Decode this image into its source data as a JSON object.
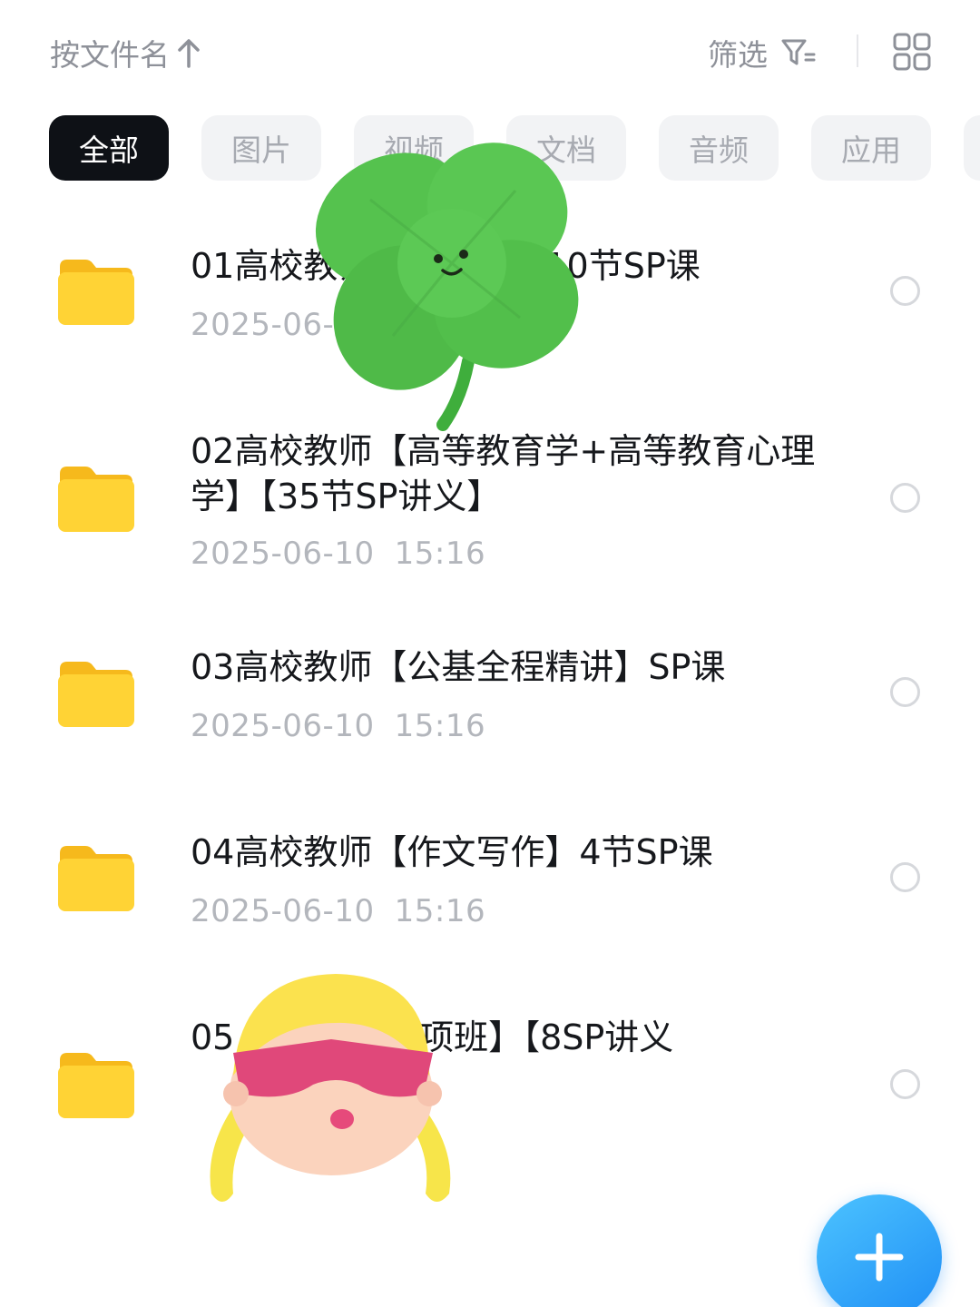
{
  "topbar": {
    "sort_label": "按文件名",
    "sort_direction_icon": "arrow-up-icon",
    "filter_label": "筛选",
    "filter_icon": "filter-icon",
    "grid_icon": "grid-view-icon"
  },
  "tabs": [
    {
      "label": "全部",
      "active": true
    },
    {
      "label": "图片"
    },
    {
      "label": "视频"
    },
    {
      "label": "文档"
    },
    {
      "label": "音频"
    },
    {
      "label": "应用"
    }
  ],
  "files": [
    {
      "title": "01高校教师【…解读】10节SP课",
      "date": "2025-06-1…",
      "time": ""
    },
    {
      "title": "02高校教师【高等教育学+高等教育心理学】【35节SP讲义】",
      "date": "2025-06-10",
      "time": "15:16"
    },
    {
      "title": "03高校教师【公基全程精讲】SP课",
      "date": "2025-06-10",
      "time": "15:16"
    },
    {
      "title": "04高校教师【作文写作】4节SP课",
      "date": "2025-06-10",
      "time": "15:16"
    },
    {
      "title": "05…主观题-专项班】【8SP讲义",
      "date": "",
      "time": ""
    }
  ],
  "fab": {
    "icon": "plus-icon"
  },
  "colors": {
    "active_tab_bg": "#0e1116",
    "inactive_tab_bg": "#f2f3f5",
    "folder_yellow": "#ffd335",
    "fab_blue": "#1f8ef5"
  }
}
